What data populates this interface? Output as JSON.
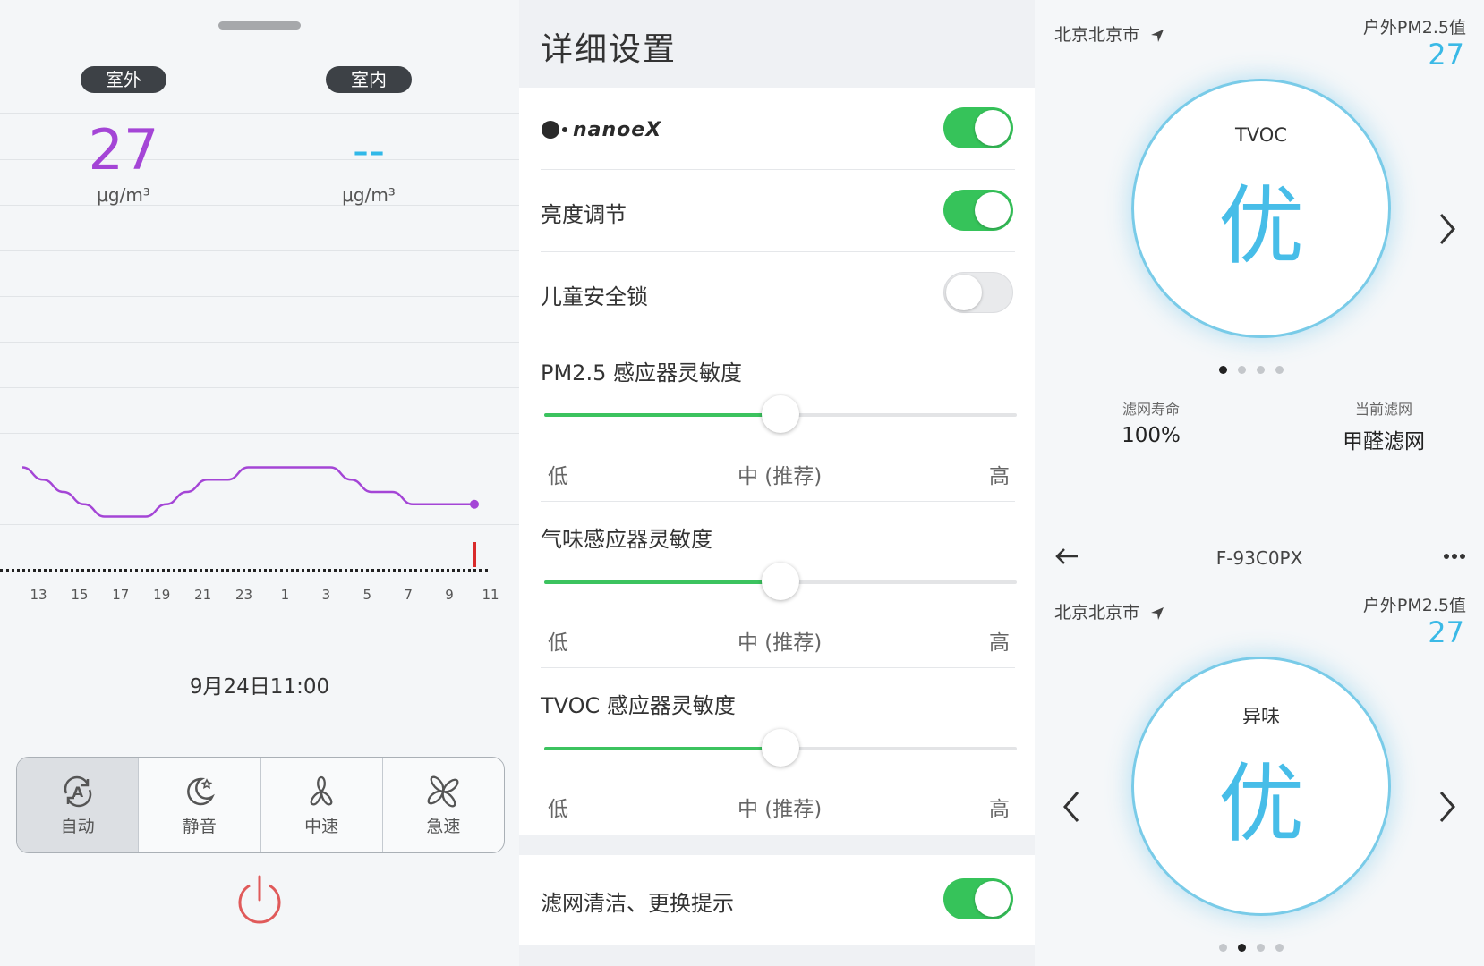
{
  "panel1": {
    "outdoor_tab": "室外",
    "indoor_tab": "室内",
    "outdoor_value": "27",
    "indoor_value": "--",
    "outdoor_unit": "μg/m³",
    "indoor_unit": "μg/m³",
    "date": "9月24日11:00",
    "modes": [
      {
        "label": "自动",
        "icon": "auto-a-icon",
        "active": true
      },
      {
        "label": "静音",
        "icon": "moon-star-icon",
        "active": false
      },
      {
        "label": "中速",
        "icon": "fan-three-blade-icon",
        "active": false
      },
      {
        "label": "急速",
        "icon": "fan-four-blade-icon",
        "active": false
      }
    ],
    "colors": {
      "outdoor": "#a445d6",
      "indoor": "#31b8e8",
      "power": "#e05a5a",
      "marker": "#d92b2b"
    }
  },
  "chart_data": {
    "type": "line",
    "x": [
      "13",
      "14",
      "15",
      "16",
      "17",
      "18",
      "19",
      "20",
      "21",
      "22",
      "23",
      "0",
      "1",
      "2",
      "3",
      "4",
      "5",
      "6",
      "7",
      "8",
      "9",
      "10",
      "11"
    ],
    "x_tick_labels": [
      "13",
      "15",
      "17",
      "19",
      "21",
      "23",
      "1",
      "3",
      "5",
      "7",
      "9",
      "11"
    ],
    "series": [
      {
        "values": [
          30,
          29,
          28,
          27,
          26,
          26,
          26,
          27,
          28,
          29,
          29,
          30,
          30,
          30,
          30,
          30,
          29,
          28,
          28,
          27,
          27,
          27,
          27
        ]
      }
    ],
    "grid": true,
    "current_marker": "11"
  },
  "panel2": {
    "title": "详细设置",
    "nanoe_logo": "nanoeX",
    "rows": {
      "nanoe": {
        "on": true
      },
      "brightness": {
        "label": "亮度调节",
        "on": true
      },
      "child_lock": {
        "label": "儿童安全锁",
        "on": false
      },
      "pm25": {
        "label": "PM2.5 感应器灵敏度",
        "level": 0.5
      },
      "odor": {
        "label": "气味感应器灵敏度",
        "level": 0.5
      },
      "tvoc": {
        "label": "TVOC 感应器灵敏度",
        "level": 0.5
      },
      "filter_reminder": {
        "label": "滤网清洁、更换提示",
        "on": true
      }
    },
    "levels": {
      "low": "低",
      "mid": "中 (推荐)",
      "high": "高"
    }
  },
  "panel3": {
    "city": "北京北京市",
    "outdoor_label": "户外PM2.5值",
    "outdoor_value": "27",
    "ring1_label": "TVOC",
    "ring1_value": "优",
    "filter_life_label": "滤网寿命",
    "filter_life_value": "100%",
    "current_filter_label": "当前滤网",
    "current_filter_value": "甲醛滤网",
    "device_name": "F-93C0PX",
    "ring2_label": "异味",
    "ring2_value": "优",
    "ring_color": "#47bde8"
  }
}
